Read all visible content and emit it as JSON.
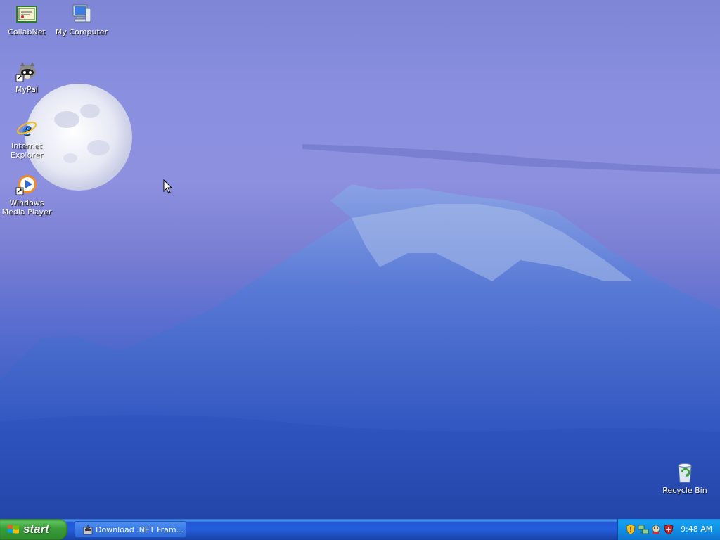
{
  "desktop": {
    "icons": [
      {
        "name": "collabnet",
        "label": "CollabNet",
        "icon": "collabnet-certificate-icon"
      },
      {
        "name": "my-computer",
        "label": "My Computer",
        "icon": "my-computer-icon"
      },
      {
        "name": "mypal",
        "label": "MyPal",
        "icon": "mypal-raccoon-icon"
      },
      {
        "name": "internet-explorer",
        "label": "Internet Explorer",
        "icon": "internet-explorer-icon"
      },
      {
        "name": "windows-media-player",
        "label": "Windows Media Player",
        "icon": "windows-media-player-icon"
      },
      {
        "name": "recycle-bin",
        "label": "Recycle Bin",
        "icon": "recycle-bin-icon"
      }
    ]
  },
  "taskbar": {
    "start_label": "start",
    "task": {
      "label": "Download .NET Fram...",
      "icon": "installer-icon"
    },
    "tray": {
      "icons": [
        "security-shield-icon",
        "network-icon",
        "agent-icon",
        "security-center-icon"
      ],
      "clock": "9:48 AM"
    }
  },
  "colors": {
    "taskbar_blue": "#245edb",
    "start_green": "#3a9d3a",
    "tray_blue": "#1290e6",
    "desktop_sky": "#8a8fe0",
    "mountain_blue": "#2b4fb0"
  }
}
